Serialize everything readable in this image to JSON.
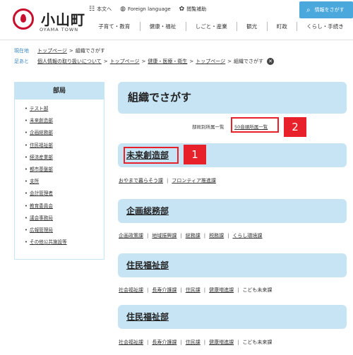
{
  "header": {
    "logo_name": "小山町",
    "logo_sub": "OYAMA TOWN",
    "util": [
      {
        "icon": "text-icon",
        "glyph": "☷",
        "label": "本文へ"
      },
      {
        "icon": "globe-icon",
        "glyph": "◍",
        "label": "Foreign language"
      },
      {
        "icon": "gear-icon",
        "glyph": "✿",
        "label": "閲覧補助"
      }
    ],
    "search_label": "情報をさがす",
    "search_icon": "search-icon",
    "nav": [
      "子育て・教育",
      "健康・福祉",
      "しごと・産業",
      "観光",
      "町政",
      "くらし・手続き"
    ]
  },
  "breadcrumb": {
    "current_tag": "現在地",
    "current": [
      "トップページ",
      "組織でさがす"
    ],
    "footprint_tag": "足あと",
    "footprint": [
      "個人情報の取り扱いについて",
      "トップページ",
      "健康・医療・衛生",
      "トップページ",
      "組織でさがす"
    ]
  },
  "sidebar": {
    "title": "部局",
    "items": [
      "テスト部",
      "未来創造部",
      "企画総務部",
      "住民福祉部",
      "経済産業部",
      "都市基盤部",
      "支所",
      "会計管理者",
      "教育委員会",
      "議会事務局",
      "広報管理局",
      "その他公共施設等"
    ]
  },
  "main": {
    "title": "組織でさがす",
    "tab_by_dept": "部局別所属一覧",
    "tab_50": "50音順所属一覧",
    "badge_1": "1",
    "badge_2": "2",
    "sections": [
      {
        "name": "未来創造部",
        "links": [
          "おやまで暮らそう課",
          "フロンティア推進課"
        ],
        "last_plain": false
      },
      {
        "name": "企画総務部",
        "links": [
          "企画政策課",
          "地域振興課",
          "総務課",
          "税務課",
          "くらし環境課"
        ],
        "last_plain": false
      },
      {
        "name": "住民福祉部",
        "links": [
          "社会福祉課",
          "長寿介護課",
          "住民課",
          "健康増進課",
          "こども未来課"
        ],
        "last_plain": true
      },
      {
        "name": "住民福祉部",
        "links": [
          "社会福祉課",
          "長寿介護課",
          "住民課",
          "健康増進課",
          "こども未来課"
        ],
        "last_plain": true
      }
    ]
  },
  "colors": {
    "accent": "#4ba8dd",
    "section_bg": "#c7e4f5",
    "highlight": "#e8202a",
    "logo_red": "#c8102e"
  }
}
